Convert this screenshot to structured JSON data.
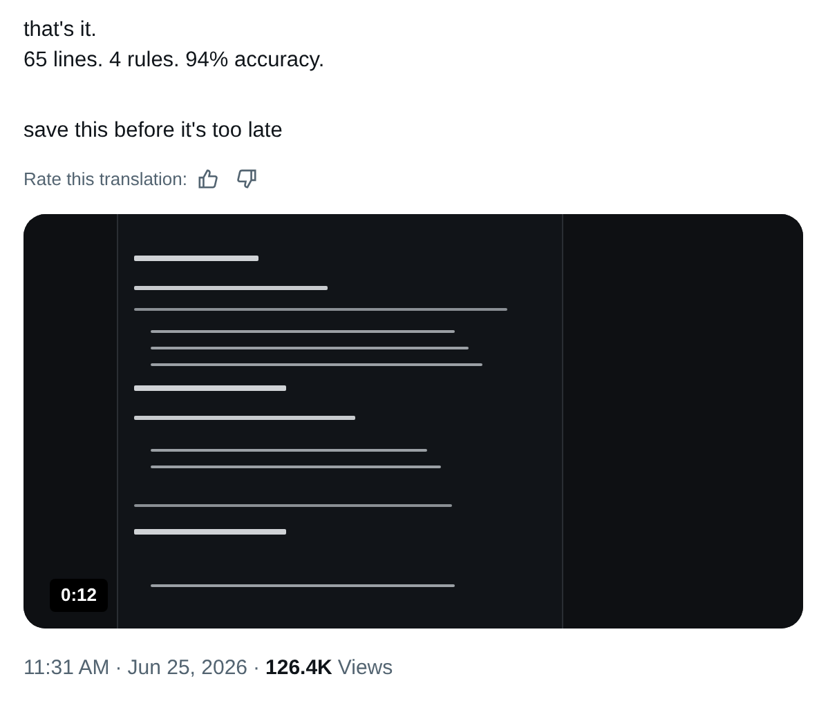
{
  "post": {
    "paragraphs": [
      {
        "lines": [
          "that's it.",
          "65 lines. 4 rules. 94% accuracy."
        ]
      },
      {
        "lines": [
          "save this before it's too late"
        ]
      }
    ],
    "rate_label": "Rate this translation:",
    "video": {
      "kind": "picture",
      "duration": "0:12"
    },
    "meta": {
      "time": "11:31 AM",
      "separator_1": "·",
      "date": "Jun 25, 2026",
      "separator_2": "·",
      "views_count": "126.4K",
      "views_label": "Views"
    }
  }
}
